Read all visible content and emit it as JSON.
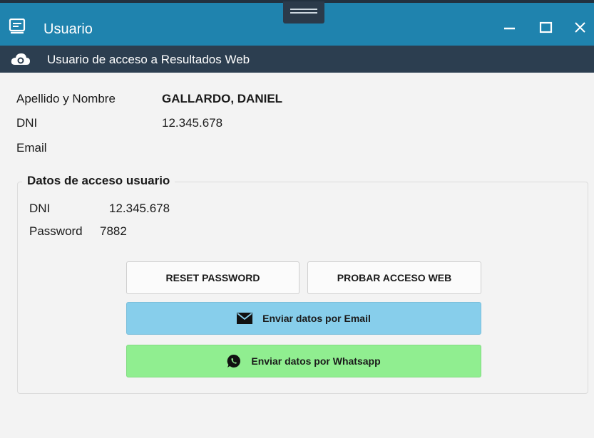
{
  "window": {
    "title": "Usuario",
    "app_icon": "form-app-icon",
    "controls": {
      "minimize": "minimize-icon",
      "maximize": "maximize-icon",
      "close": "close-icon"
    }
  },
  "subheader": {
    "icon": "cloud-globe-icon",
    "text": "Usuario de acceso a Resultados Web"
  },
  "user": {
    "name_label": "Apellido y Nombre",
    "name_value": "GALLARDO, DANIEL",
    "dni_label": "DNI",
    "dni_value": "12.345.678",
    "email_label": "Email",
    "email_value": ""
  },
  "access": {
    "title": "Datos de acceso usuario",
    "dni_label": "DNI",
    "dni_value": "12.345.678",
    "password_label": "Password",
    "password_value": "7882"
  },
  "buttons": {
    "reset_password": "RESET PASSWORD",
    "probar_acceso": "PROBAR ACCESO WEB",
    "email": {
      "label": "Enviar datos por Email",
      "icon": "envelope-icon",
      "color": "#87ceeb"
    },
    "whatsapp": {
      "label": "Enviar datos por Whatsapp",
      "icon": "whatsapp-icon",
      "color": "#90ee90"
    }
  },
  "colors": {
    "titlebar": "#1f83ae",
    "subbar": "#2c3e50",
    "background": "#f3f3f3"
  }
}
